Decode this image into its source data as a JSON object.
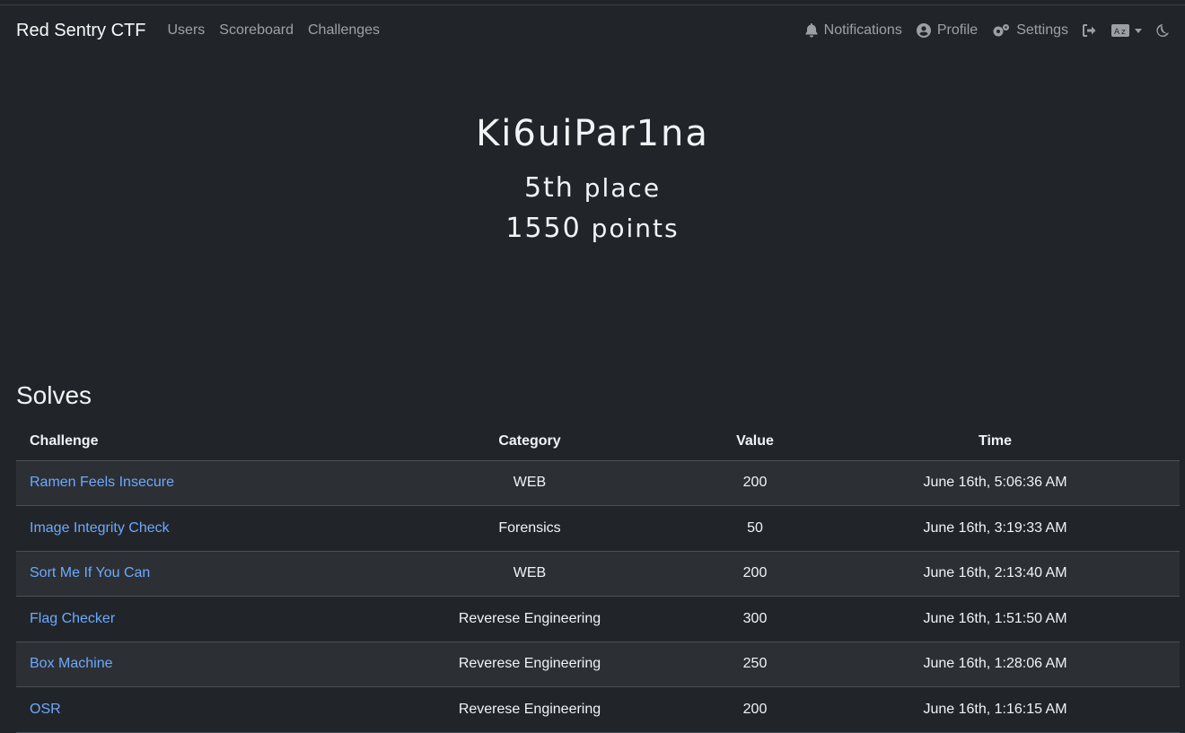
{
  "nav": {
    "brand": "Red Sentry CTF",
    "left": [
      "Users",
      "Scoreboard",
      "Challenges"
    ],
    "notifications": "Notifications",
    "profile": "Profile",
    "settings": "Settings",
    "icons": [
      "bell-icon",
      "user-circle-icon",
      "cogs-icon",
      "logout-icon",
      "language-icon",
      "moon-icon"
    ]
  },
  "user": {
    "name": "Ki6uiPar1na",
    "place_num": "5th",
    "place_label": "place",
    "points_num": "1550",
    "points_label": "points"
  },
  "solves": {
    "title": "Solves",
    "headers": [
      "Challenge",
      "Category",
      "Value",
      "Time"
    ],
    "rows": [
      [
        "Ramen Feels Insecure",
        "WEB",
        "200",
        "June 16th, 5:06:36 AM"
      ],
      [
        "Image Integrity Check",
        "Forensics",
        "50",
        "June 16th, 3:19:33 AM"
      ],
      [
        "Sort Me If You Can",
        "WEB",
        "200",
        "June 16th, 2:13:40 AM"
      ],
      [
        "Flag Checker",
        "Reverese Engineering",
        "300",
        "June 16th, 1:51:50 AM"
      ],
      [
        "Box Machine",
        "Reverese Engineering",
        "250",
        "June 16th, 1:28:06 AM"
      ],
      [
        "OSR",
        "Reverese Engineering",
        "200",
        "June 16th, 1:16:15 AM"
      ]
    ]
  },
  "colors": {
    "background": "#212529",
    "link": "#6ea8fe",
    "stripe": "#2c3034"
  }
}
